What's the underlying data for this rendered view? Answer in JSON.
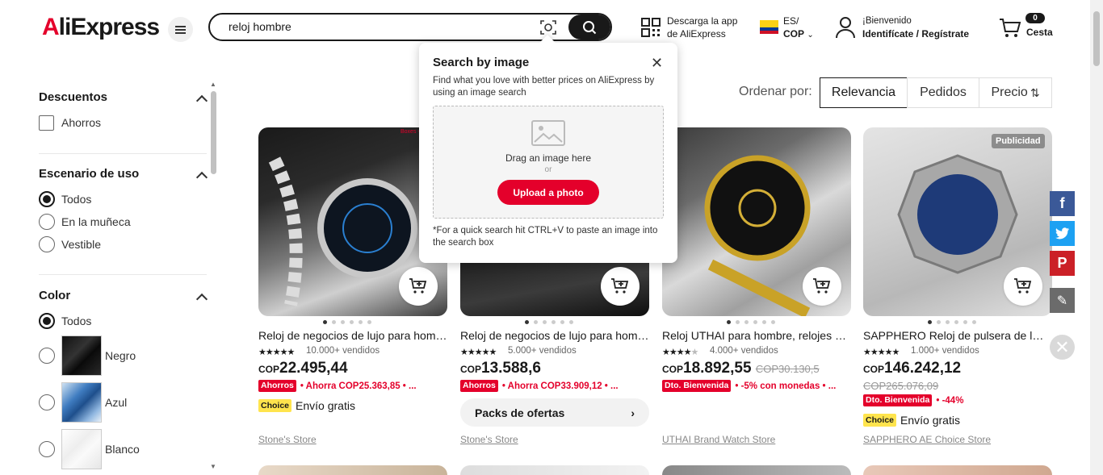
{
  "header": {
    "logo_a": "A",
    "logo_rest": "liExpress",
    "search_value": "reloj hombre",
    "app_line1": "Descarga la app",
    "app_line2": "de AliExpress",
    "lang_line1": "ES/",
    "lang_line2": "COP",
    "welcome_line1": "¡Bienvenido",
    "welcome_line2": "Identifícate / Regístrate",
    "cart_count": "0",
    "cart_label": "Cesta"
  },
  "sidebar": {
    "descuentos": {
      "title": "Descuentos",
      "options": [
        "Ahorros"
      ]
    },
    "escenario": {
      "title": "Escenario de uso",
      "options": [
        "Todos",
        "En la muñeca",
        "Vestible"
      ]
    },
    "color": {
      "title": "Color",
      "options": [
        "Todos",
        "Negro",
        "Azul",
        "Blanco"
      ]
    }
  },
  "sort": {
    "label": "Ordenar por:",
    "options": [
      "Relevancia",
      "Pedidos",
      "Precio"
    ]
  },
  "popup": {
    "title": "Search by image",
    "desc": "Find what you love with better prices on AliExpress by using an image search",
    "drag": "Drag an image here",
    "or": "or",
    "upload": "Upload a photo",
    "footer": "*For a quick search hit CTRL+V to paste an image into the search box"
  },
  "products": [
    {
      "title": "Reloj de negocios de lujo para hombre...",
      "sold": "10.000+ vendidos",
      "currency": "COP",
      "price": "22.495,44",
      "tag": "Ahorros",
      "promo": "• Ahorra COP25.363,85 • ...",
      "choice": "Choice",
      "shipping": "Envío gratis",
      "store": "Stone's Store",
      "overlay": "Boxes +"
    },
    {
      "title": "Reloj de negocios de lujo para hombre...",
      "sold": "5.000+ vendidos",
      "currency": "COP",
      "price": "13.588,6",
      "tag": "Ahorros",
      "promo": "• Ahorra COP33.909,12 • ...",
      "packs": "Packs de ofertas",
      "store": "Stone's Store"
    },
    {
      "title": "Reloj UTHAI para hombre, relojes de...",
      "sold": "4.000+ vendidos",
      "currency": "COP",
      "price": "18.892,55",
      "old_price": "COP30.130,5",
      "tag": "Dto. Bienvenida",
      "promo": "• -5% con monedas • ...",
      "store": "UTHAI Brand Watch Store"
    },
    {
      "title": "SAPPHERO Reloj de pulsera de lujo...",
      "sold": "1.000+ vendidos",
      "currency": "COP",
      "price": "146.242,12",
      "old_price": "COP265.076,09",
      "tag": "Dto. Bienvenida",
      "promo": "• -44%",
      "choice": "Choice",
      "shipping": "Envío gratis",
      "store": "SAPPHERO AE Choice Store",
      "ad": "Publicidad"
    }
  ],
  "colors": {
    "brand_red": "#e4002b",
    "dark": "#191919",
    "facebook": "#3b5998",
    "twitter": "#1da1f2",
    "pinterest": "#cb2027"
  }
}
